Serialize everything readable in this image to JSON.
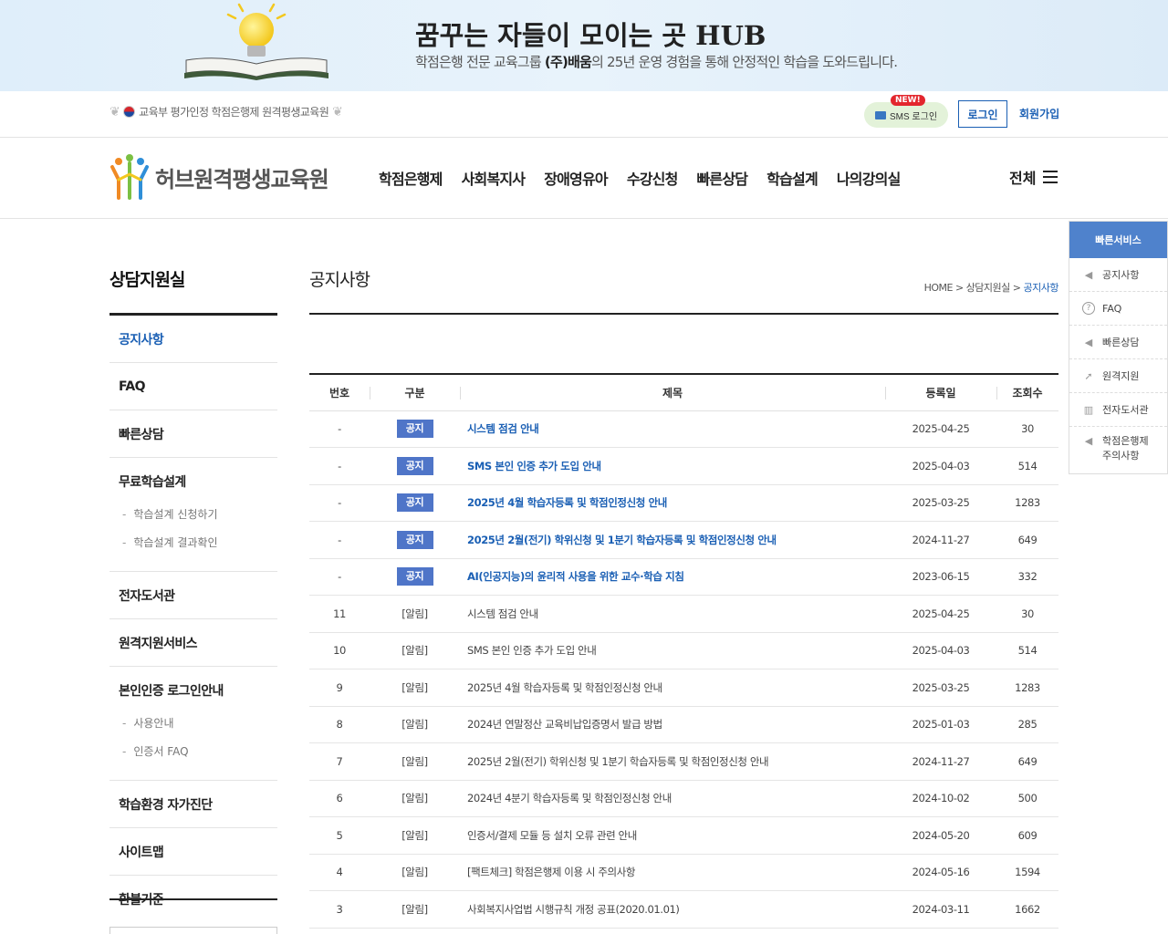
{
  "banner": {
    "title": "꿈꾸는 자들이 모이는 곳 HUB",
    "subtitle_pre": "학점은행 전문 교육그룹 ",
    "subtitle_bold": "(주)배움",
    "subtitle_post": "의 25년 운영 경험을 통해 안정적인 학습을 도와드립니다."
  },
  "topbar": {
    "certification": "교육부 평가인정 학점은행제 원격평생교육원",
    "new_badge": "NEW!",
    "sms_login": "SMS 로그인",
    "login": "로그인",
    "join": "회원가입"
  },
  "header": {
    "logo_text": "허브원격평생교육원",
    "nav": [
      "학점은행제",
      "사회복지사",
      "장애영유아",
      "수강신청",
      "빠른상담",
      "학습설계",
      "나의강의실"
    ],
    "all_menu": "전체"
  },
  "quick": {
    "title": "빠른서비스",
    "items": [
      {
        "label": "공지사항",
        "icon": "speaker-icon"
      },
      {
        "label": "FAQ",
        "icon": "question-icon"
      },
      {
        "label": "빠른상담",
        "icon": "speaker-icon"
      },
      {
        "label": "원격지원",
        "icon": "cursor-icon"
      },
      {
        "label": "전자도서관",
        "icon": "library-icon"
      },
      {
        "label": "학점은행제 주의사항",
        "icon": "speaker-icon"
      }
    ]
  },
  "lnb": {
    "title": "상담지원실",
    "items": [
      {
        "label": "공지사항",
        "active": true
      },
      {
        "label": "FAQ"
      },
      {
        "label": "빠른상담"
      },
      {
        "label": "무료학습설계",
        "subs": [
          "학습설계 신청하기",
          "학습설계 결과확인"
        ]
      },
      {
        "label": "전자도서관"
      },
      {
        "label": "원격지원서비스"
      },
      {
        "label": "본인인증 로그인안내",
        "subs": [
          "사용안내",
          "인증서 FAQ"
        ]
      },
      {
        "label": "학습환경 자가진단"
      },
      {
        "label": "사이트맵"
      },
      {
        "label": "환불기준"
      }
    ]
  },
  "content": {
    "page_title": "공지사항",
    "breadcrumb": {
      "home": "HOME",
      "sep": " > ",
      "parent": "상담지원실",
      "current": "공지사항"
    },
    "columns": [
      "번호",
      "구분",
      "제목",
      "등록일",
      "조회수"
    ],
    "notice_badge": "공지",
    "rows": [
      {
        "no": "-",
        "type": "공지",
        "title": "시스템 점검 안내",
        "date": "2025-04-25",
        "views": "30",
        "notice": true
      },
      {
        "no": "-",
        "type": "공지",
        "title": "SMS 본인 인증 추가 도입 안내",
        "date": "2025-04-03",
        "views": "514",
        "notice": true
      },
      {
        "no": "-",
        "type": "공지",
        "title": "2025년 4월 학습자등록 및 학점인정신청 안내",
        "date": "2025-03-25",
        "views": "1283",
        "notice": true
      },
      {
        "no": "-",
        "type": "공지",
        "title": "2025년 2월(전기) 학위신청 및 1분기 학습자등록 및 학점인정신청 안내",
        "date": "2024-11-27",
        "views": "649",
        "notice": true
      },
      {
        "no": "-",
        "type": "공지",
        "title": "AI(인공지능)의 윤리적 사용을 위한 교수·학습 지침",
        "date": "2023-06-15",
        "views": "332",
        "notice": true
      },
      {
        "no": "11",
        "type": "[알림]",
        "title": "시스템 점검 안내",
        "date": "2025-04-25",
        "views": "30"
      },
      {
        "no": "10",
        "type": "[알림]",
        "title": "SMS 본인 인증 추가 도입 안내",
        "date": "2025-04-03",
        "views": "514"
      },
      {
        "no": "9",
        "type": "[알림]",
        "title": "2025년 4월 학습자등록 및 학점인정신청 안내",
        "date": "2025-03-25",
        "views": "1283"
      },
      {
        "no": "8",
        "type": "[알림]",
        "title": "2024년 연말정산 교육비납입증명서 발급 방법",
        "date": "2025-01-03",
        "views": "285"
      },
      {
        "no": "7",
        "type": "[알림]",
        "title": "2025년 2월(전기) 학위신청 및 1분기 학습자등록 및 학점인정신청 안내",
        "date": "2024-11-27",
        "views": "649"
      },
      {
        "no": "6",
        "type": "[알림]",
        "title": "2024년 4분기 학습자등록 및 학점인정신청 안내",
        "date": "2024-10-02",
        "views": "500"
      },
      {
        "no": "5",
        "type": "[알림]",
        "title": "인증서/결제 모듈 등 설치 오류 관련 안내",
        "date": "2024-05-20",
        "views": "609"
      },
      {
        "no": "4",
        "type": "[알림]",
        "title": "[팩트체크] 학점은행제 이용 시 주의사항",
        "date": "2024-05-16",
        "views": "1594"
      },
      {
        "no": "3",
        "type": "[알림]",
        "title": "사회복지사업법 시행규칙 개정 공표(2020.01.01)",
        "date": "2024-03-11",
        "views": "1662"
      }
    ]
  },
  "colors": {
    "brand_blue": "#1a5fb4",
    "badge_blue": "#4f75c8",
    "quick_head": "#4f82cc"
  }
}
